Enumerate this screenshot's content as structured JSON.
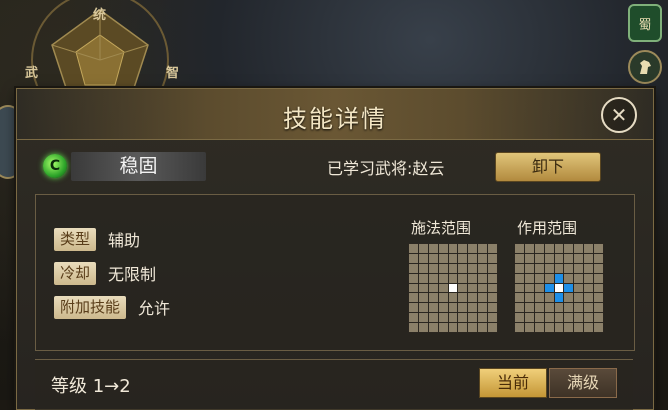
{
  "radar": {
    "stats": [
      "统",
      "武",
      "智"
    ]
  },
  "side_icons": [
    "蜀"
  ],
  "dialog": {
    "title": "技能详情",
    "close_glyph": "✕"
  },
  "skill": {
    "gem_glyph": "C",
    "name": "稳固",
    "learned_by": "已学习武将:赵云",
    "unload_label": "卸下"
  },
  "info": {
    "rows": [
      {
        "tag": "类型",
        "value": "辅助"
      },
      {
        "tag": "冷却",
        "value": "无限制"
      },
      {
        "tag": "附加技能",
        "value": "允许"
      }
    ],
    "cast_range_title": "施法范围",
    "effect_range_title": "作用范围"
  },
  "level": {
    "text": "等级 1→2",
    "current_label": "当前",
    "max_label": "满级"
  },
  "colors": {
    "accent_gold": "#c49636",
    "grid_cell": "#8b8069",
    "highlight_blue": "#1e8fe8",
    "gem_green": "#2ea52a"
  }
}
